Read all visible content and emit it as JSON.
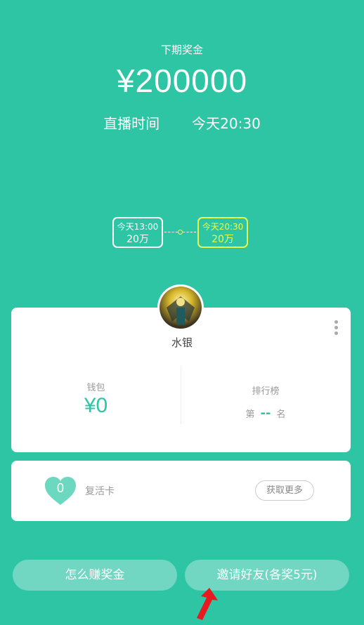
{
  "header": {
    "prize_label": "下期奖金",
    "prize_amount": "¥200000",
    "live_label": "直播时间",
    "live_time": "今天20:30"
  },
  "schedule": [
    {
      "time": "今天13:00",
      "amount": "20万",
      "active": false
    },
    {
      "time": "今天20:30",
      "amount": "20万",
      "active": true
    }
  ],
  "profile": {
    "username": "水银",
    "wallet_label": "钱包",
    "wallet_value": "¥0",
    "rank_label": "排行榜",
    "rank_prefix": "第",
    "rank_value": "--",
    "rank_suffix": "名"
  },
  "revive": {
    "count": "0",
    "label": "复活卡",
    "get_more_label": "获取更多"
  },
  "actions": {
    "how_to_earn": "怎么赚奖金",
    "invite": "邀请好友(各奖5元)"
  },
  "colors": {
    "background": "#2ec5a5",
    "highlight": "#eaff48",
    "annotation_arrow": "#e8191f"
  },
  "icons": [
    "more-vert-icon",
    "heart-icon",
    "annotation-arrow-icon"
  ]
}
